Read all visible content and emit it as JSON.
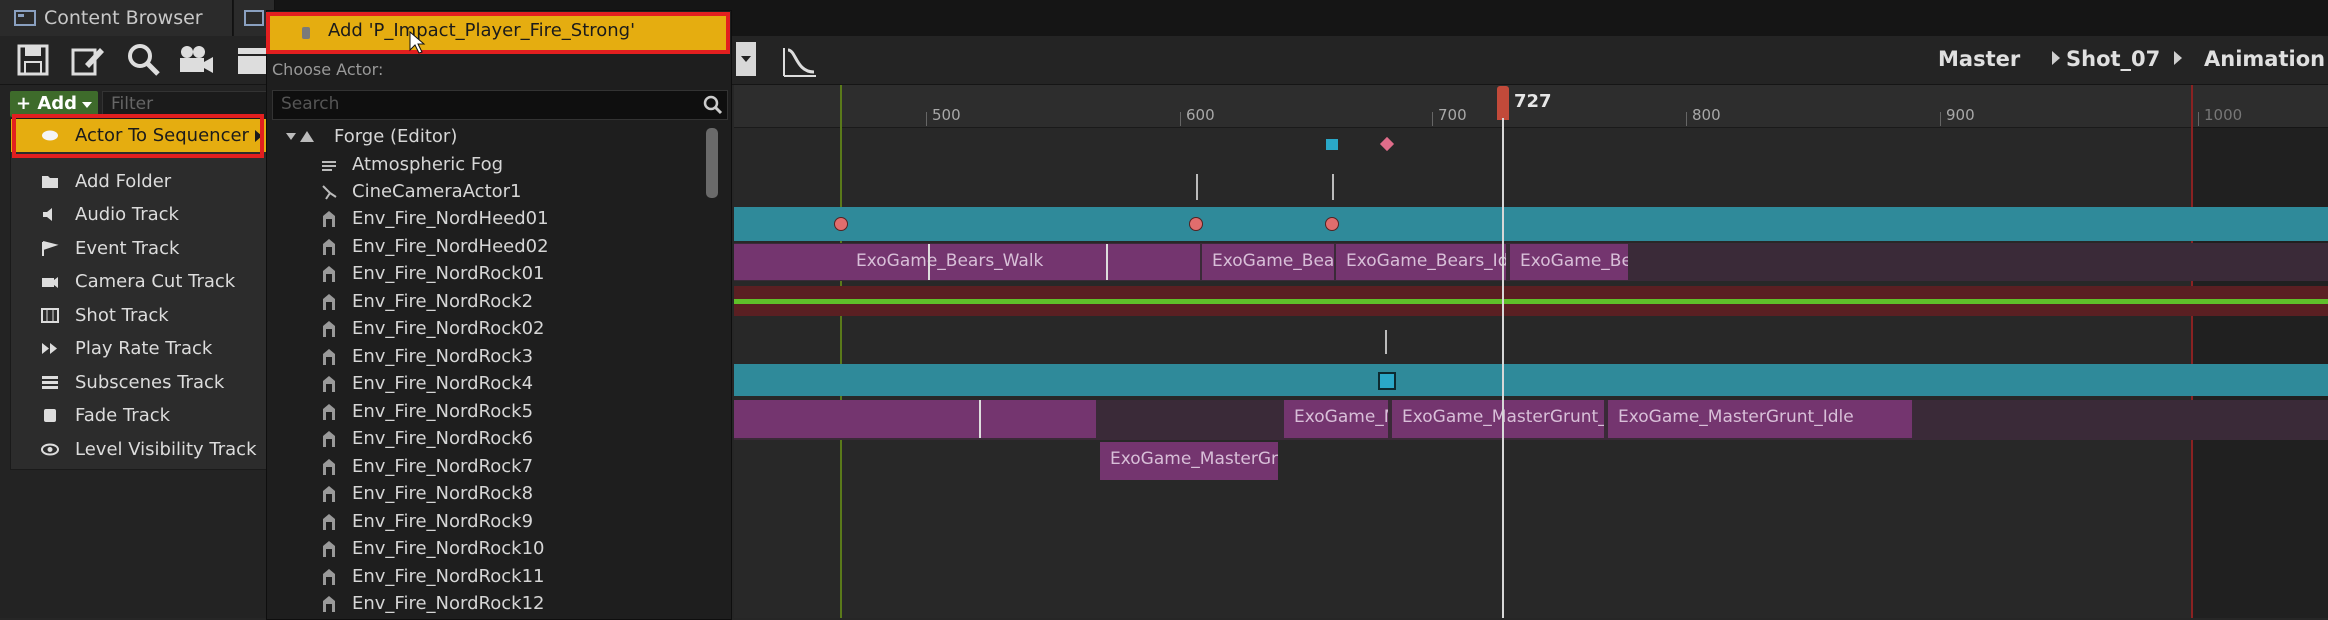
{
  "tabs": [
    {
      "label": "Content Browser"
    },
    {
      "label": ""
    }
  ],
  "breadcrumb": {
    "items": [
      "Master",
      "Shot_07",
      "Animation"
    ]
  },
  "add_button": {
    "label": "+ Add"
  },
  "filter": {
    "placeholder": "Filter"
  },
  "add_menu": {
    "items": [
      {
        "label": "Actor To Sequencer",
        "icon": "actor-icon"
      },
      {
        "label": "Add Folder",
        "icon": "folder-icon"
      },
      {
        "label": "Audio Track",
        "icon": "audio-icon"
      },
      {
        "label": "Event Track",
        "icon": "flag-icon"
      },
      {
        "label": "Camera Cut Track",
        "icon": "camera-icon"
      },
      {
        "label": "Shot Track",
        "icon": "film-icon"
      },
      {
        "label": "Play Rate Track",
        "icon": "play-rate-icon"
      },
      {
        "label": "Subscenes Track",
        "icon": "subscenes-icon"
      },
      {
        "label": "Fade Track",
        "icon": "fade-icon"
      },
      {
        "label": "Level Visibility Track",
        "icon": "eye-icon"
      }
    ]
  },
  "actor_picker": {
    "header": "Add 'P_Impact_Player_Fire_Strong'",
    "choose_label": "Choose Actor:",
    "search_placeholder": "Search",
    "root": "Forge (Editor)",
    "actors": [
      "Atmospheric Fog",
      "CineCameraActor1",
      "Env_Fire_NordHeed01",
      "Env_Fire_NordHeed02",
      "Env_Fire_NordRock01",
      "Env_Fire_NordRock2",
      "Env_Fire_NordRock02",
      "Env_Fire_NordRock3",
      "Env_Fire_NordRock4",
      "Env_Fire_NordRock5",
      "Env_Fire_NordRock6",
      "Env_Fire_NordRock7",
      "Env_Fire_NordRock8",
      "Env_Fire_NordRock9",
      "Env_Fire_NordRock10",
      "Env_Fire_NordRock11",
      "Env_Fire_NordRock12"
    ]
  },
  "timeline": {
    "current_frame": "727",
    "ticks": [
      "500",
      "600",
      "700",
      "800",
      "900",
      "1000"
    ],
    "clips": [
      "ExoGame_Bears_Walk",
      "ExoGame_Bear",
      "ExoGame_Bears_Idl",
      "ExoGame_Be",
      "ExoGame_M",
      "ExoGame_MasterGrunt_",
      "ExoGame_MasterGrunt_Idle",
      "ExoGame_MasterGru"
    ]
  },
  "colors": {
    "highlight_red": "#e21f1f",
    "menu_selected": "#e5ad10",
    "track_teal": "#2f8a9a",
    "clip_purple": "#74356f",
    "add_green": "#3e6b2b"
  }
}
